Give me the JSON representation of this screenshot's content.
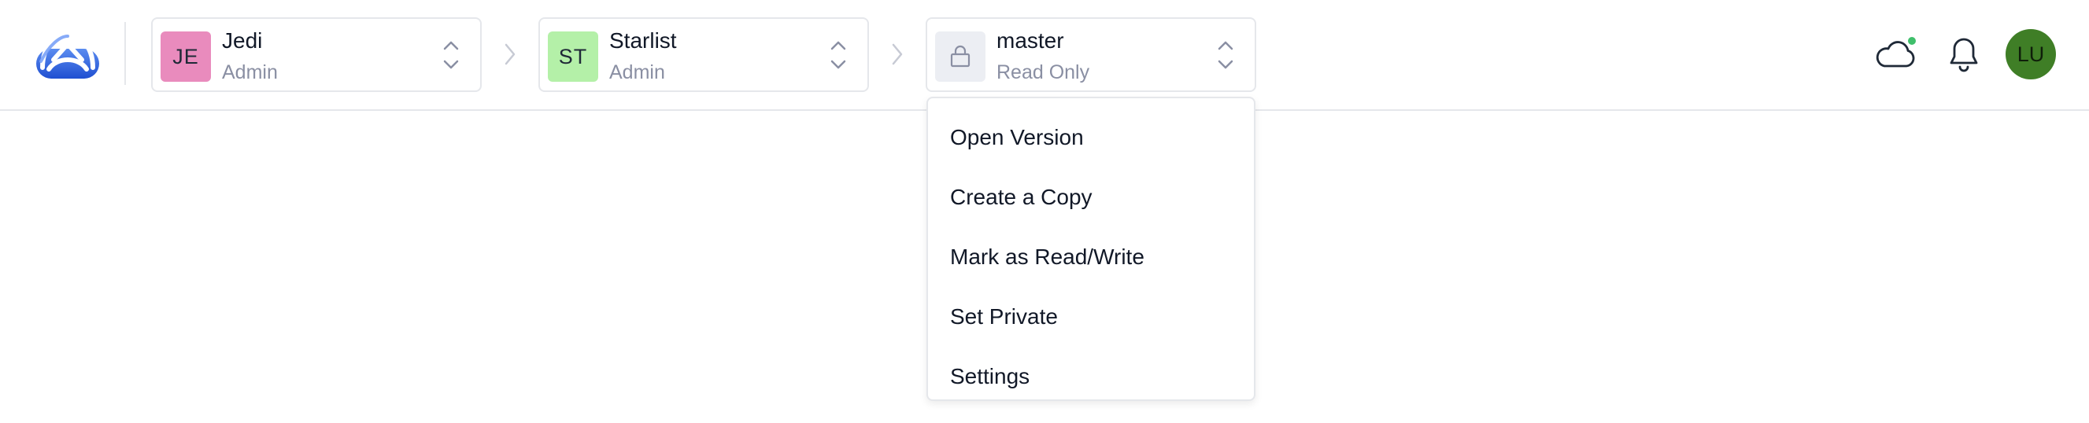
{
  "header": {
    "logo_icon": "app-logo-icon",
    "breadcrumbs": [
      {
        "initials": "JE",
        "title": "Jedi",
        "subtitle": "Admin",
        "color": "#e98bbd"
      },
      {
        "initials": "ST",
        "title": "Starlist",
        "subtitle": "Admin",
        "color": "#b4f0a8"
      },
      {
        "icon": "lock-icon",
        "title": "master",
        "subtitle": "Read Only",
        "color": "#eceef3"
      }
    ],
    "status_color": "#3fbf6b",
    "user": {
      "initials": "LU",
      "color": "#3f7e26"
    }
  },
  "version_menu": {
    "items": [
      {
        "label": "Open Version"
      },
      {
        "label": "Create a Copy"
      },
      {
        "label": "Mark as Read/Write"
      },
      {
        "label": "Set Private"
      },
      {
        "label": "Settings"
      }
    ]
  }
}
